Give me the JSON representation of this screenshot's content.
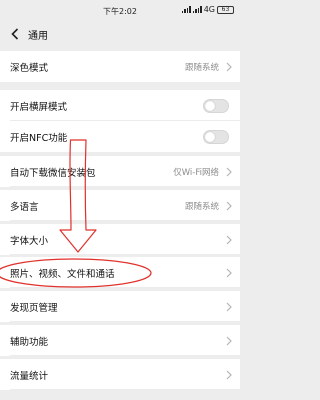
{
  "status_bar": {
    "time": "下午2:02",
    "network": "4G",
    "battery": "63"
  },
  "header": {
    "title": "通用"
  },
  "settings": {
    "dark_mode": {
      "label": "深色模式",
      "value": "跟随系统"
    },
    "landscape_mode": {
      "label": "开启横屏模式",
      "enabled": false
    },
    "nfc": {
      "label": "开启NFC功能",
      "enabled": false
    },
    "auto_download": {
      "label": "自动下载微信安装包",
      "value": "仅Wi-Fi网络"
    },
    "language": {
      "label": "多语言",
      "value": "跟随系统"
    },
    "font_size": {
      "label": "字体大小"
    },
    "media_files": {
      "label": "照片、视频、文件和通话"
    },
    "discover_manage": {
      "label": "发现页管理"
    },
    "accessibility": {
      "label": "辅助功能"
    },
    "data_usage": {
      "label": "流量统计"
    }
  },
  "colors": {
    "background": "#ededed",
    "row": "#ffffff",
    "annotation": "#e0312b",
    "value_text": "#8c8c8c"
  }
}
